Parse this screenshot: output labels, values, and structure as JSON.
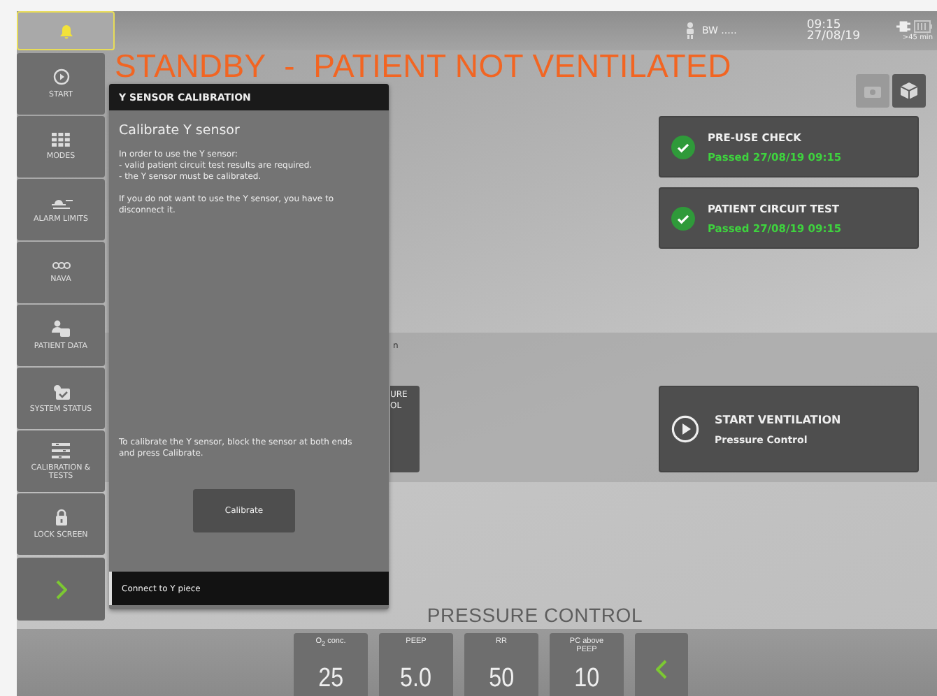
{
  "top_bar": {
    "alarm_active": true,
    "patient": "BW .....",
    "time": "09:15",
    "date": "27/08/19",
    "battery": ">45 min"
  },
  "sidebar": {
    "items": [
      {
        "kind": "start",
        "label": "START"
      },
      {
        "kind": "modes",
        "label": "MODES"
      },
      {
        "kind": "alarm",
        "label": "ALARM LIMITS"
      },
      {
        "kind": "nava",
        "label": "NAVA"
      },
      {
        "kind": "patient",
        "label": "PATIENT DATA"
      },
      {
        "kind": "system",
        "label": "SYSTEM STATUS"
      },
      {
        "kind": "calibration",
        "label": "CALIBRATION & TESTS"
      },
      {
        "kind": "lock",
        "label": "LOCK SCREEN"
      }
    ]
  },
  "title": "STANDBY  -  PATIENT NOT VENTILATED",
  "view_buttons": [
    {
      "kind": "camera",
      "selected": false
    },
    {
      "kind": "cube",
      "selected": true
    }
  ],
  "checks": [
    {
      "title": "PRE-USE CHECK",
      "status": "Passed 27/08/19 09:15",
      "passed": true
    },
    {
      "title": "PATIENT CIRCUIT TEST",
      "status": "Passed 27/08/19 09:15",
      "passed": true
    }
  ],
  "hidden_panel": {
    "label": "n",
    "card_lines": [
      "URE",
      "OL"
    ]
  },
  "start_ventilation": {
    "title": "START VENTILATION",
    "mode": "Pressure Control"
  },
  "dialog": {
    "title": "Y SENSOR CALIBRATION",
    "heading": "Calibrate Y sensor",
    "lines": [
      "In order to use the Y sensor:",
      "- valid patient circuit test results are required.",
      "- the Y sensor must be calibrated."
    ],
    "note": "If you do not want to use the Y sensor, you have to disconnect it.",
    "instruction": "To calibrate the Y sensor, block the sensor at both ends and press Calibrate.",
    "button": "Calibrate",
    "status": "Connect to Y piece"
  },
  "mode_label": "PRESSURE CONTROL",
  "settings": [
    {
      "label": "O$_{2}$ conc.",
      "value": "25"
    },
    {
      "label": "PEEP",
      "value": "5.0"
    },
    {
      "label": "RR",
      "value": "50"
    },
    {
      "label": "PC above PEEP",
      "value": "10"
    }
  ]
}
